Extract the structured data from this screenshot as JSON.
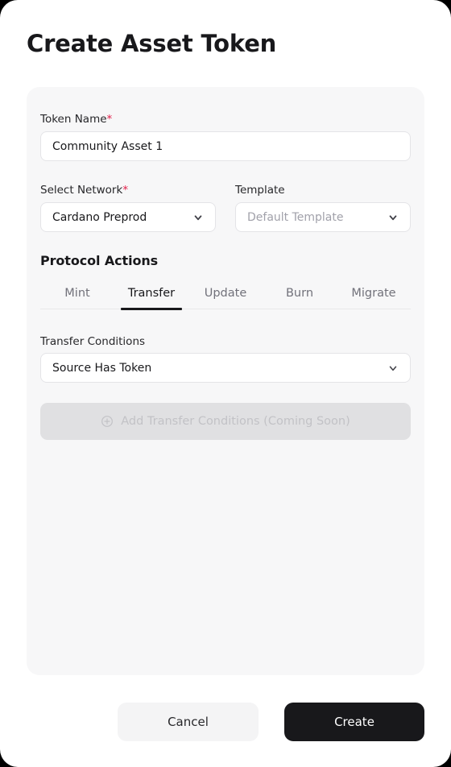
{
  "page": {
    "title": "Create Asset Token",
    "background": "#ffffff",
    "card_background": "#f7f7f8",
    "accent": "#18181b",
    "required_color": "#e11d48"
  },
  "form": {
    "token_name": {
      "label": "Token Name",
      "required_marker": "*",
      "value": "Community Asset 1",
      "placeholder": "Token Name"
    },
    "network": {
      "label": "Select Network",
      "required_marker": "*",
      "value": "Cardano Preprod",
      "icon": "chevron-down-icon"
    },
    "template": {
      "label": "Template",
      "value": "",
      "placeholder": "Default Template",
      "icon": "chevron-down-icon"
    }
  },
  "protocol_actions": {
    "heading": "Protocol Actions",
    "tabs": [
      {
        "label": "Mint",
        "active": false
      },
      {
        "label": "Transfer",
        "active": true
      },
      {
        "label": "Update",
        "active": false
      },
      {
        "label": "Burn",
        "active": false
      },
      {
        "label": "Migrate",
        "active": false
      }
    ],
    "active_tab": "Transfer"
  },
  "transfer_conditions": {
    "label": "Transfer Conditions",
    "value": "Source Has Token",
    "icon": "chevron-down-icon",
    "add_button": {
      "label": "Add Transfer Conditions (Coming Soon)",
      "icon": "plus-circle-icon",
      "disabled": true
    }
  },
  "footer": {
    "cancel_label": "Cancel",
    "create_label": "Create"
  }
}
